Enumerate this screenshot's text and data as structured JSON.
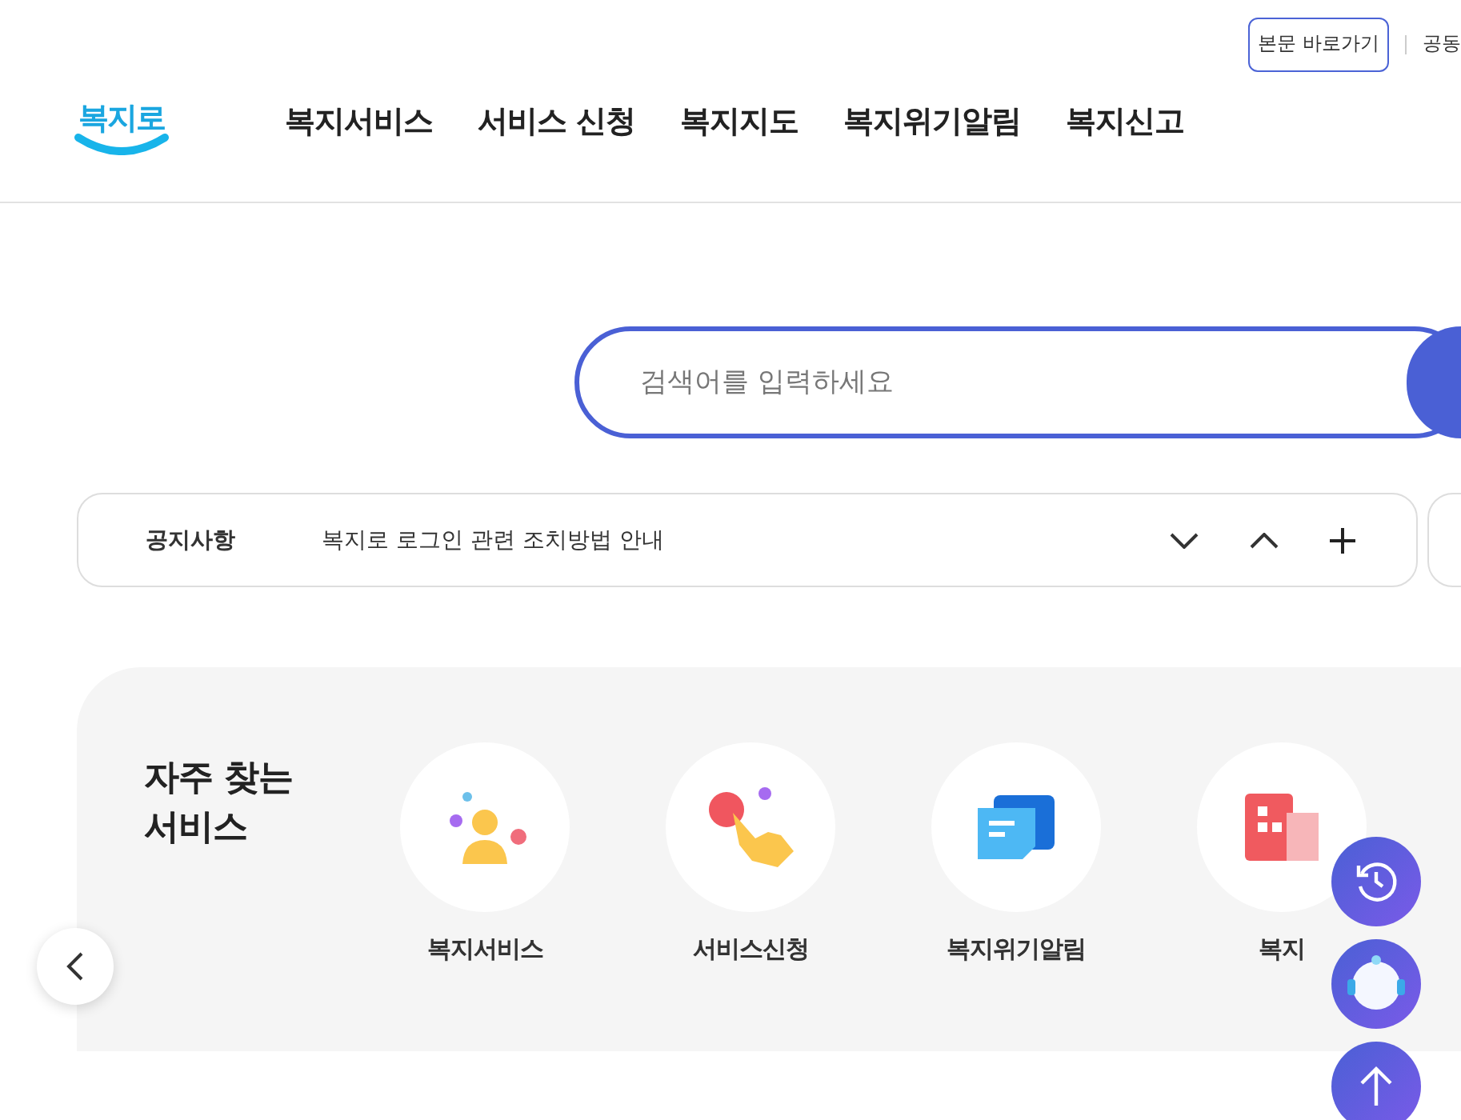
{
  "header": {
    "logo": "복지로",
    "skip_link": "본문 바로가기",
    "utility_link": "공동",
    "nav": [
      "복지서비스",
      "서비스 신청",
      "복지지도",
      "복지위기알림",
      "복지신고"
    ]
  },
  "search": {
    "placeholder": "검색어를 입력하세요"
  },
  "notice": {
    "label": "공지사항",
    "text": "복지로 로그인 관련 조치방법 안내"
  },
  "frequent": {
    "title": "자주 찾는\n서비스",
    "items": [
      {
        "kind": "person",
        "label": "복지서비스"
      },
      {
        "kind": "hand",
        "label": "서비스신청"
      },
      {
        "kind": "message",
        "label": "복지위기알림"
      },
      {
        "kind": "grid",
        "label": "복지"
      }
    ]
  }
}
